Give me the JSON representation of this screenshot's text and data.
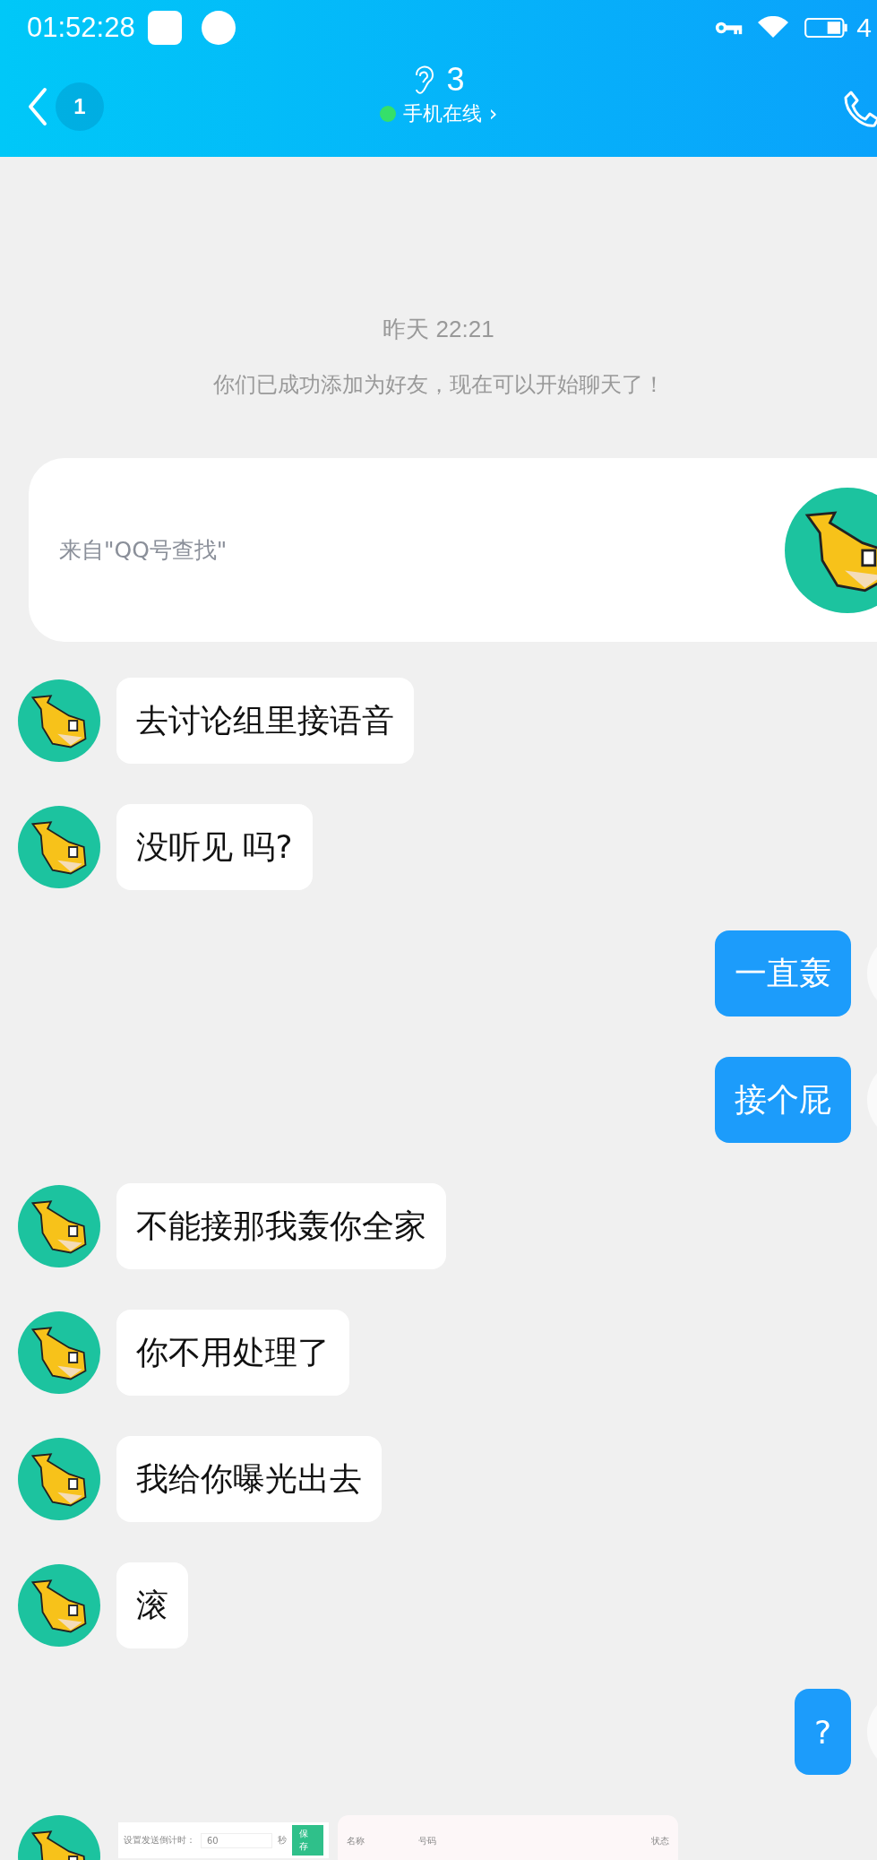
{
  "status_bar": {
    "time": "01:52:28",
    "battery_text": "4"
  },
  "header": {
    "back_badge": "1",
    "title": "3",
    "status": "手机在线",
    "status_arrow": "›",
    "online": true
  },
  "timestamp": "昨天 22:21",
  "system_message": "你们已成功添加为好友，现在可以开始聊天了！",
  "source_card": {
    "text": "来自\"QQ号查找\""
  },
  "messages": [
    {
      "outgoing": false,
      "kind": "text",
      "text": "去讨论组里接语音"
    },
    {
      "outgoing": false,
      "kind": "text",
      "text": "没听见 吗?"
    },
    {
      "outgoing": true,
      "kind": "text",
      "text": "一直轰"
    },
    {
      "outgoing": true,
      "kind": "text",
      "text": "接个屁"
    },
    {
      "outgoing": false,
      "kind": "text",
      "text": "不能接那我轰你全家"
    },
    {
      "outgoing": false,
      "kind": "text",
      "text": "你不用处理了"
    },
    {
      "outgoing": false,
      "kind": "text",
      "text": "我给你曝光出去"
    },
    {
      "outgoing": false,
      "kind": "text",
      "text": "滚"
    },
    {
      "outgoing": true,
      "kind": "text",
      "text": "?"
    },
    {
      "outgoing": false,
      "kind": "image",
      "shot": {
        "label": "设置发送倒计时：",
        "value": "60",
        "unit": "秒",
        "button": "保存",
        "columns": [
          "名称",
          "号码",
          "状态"
        ]
      }
    }
  ]
}
